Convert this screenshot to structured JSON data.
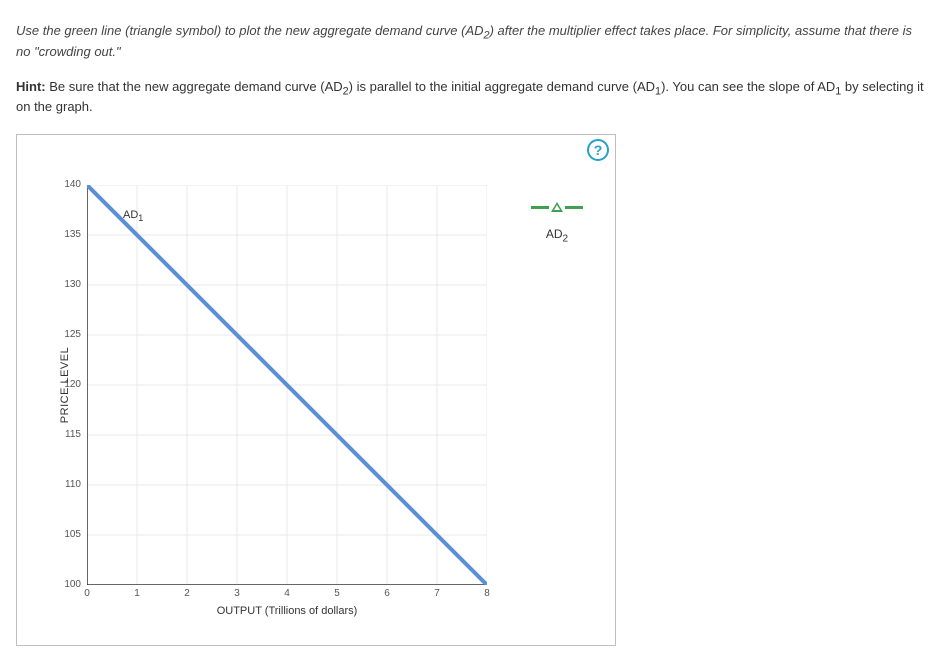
{
  "instruction": {
    "pre": "Use the green line (triangle symbol) to plot the new aggregate demand curve (",
    "var1": "AD",
    "sub1": "2",
    "post1": ") after the multiplier effect takes place. For simplicity, assume that there is no \"crowding out.\""
  },
  "hint": {
    "label": "Hint:",
    "p1": " Be sure that the new aggregate demand curve (",
    "v1": "AD",
    "s1": "2",
    "p2": ") is parallel to the initial aggregate demand curve (",
    "v2": "AD",
    "s2": "1",
    "p3": "). You can see the slope of ",
    "v3": "AD",
    "s3": "1",
    "p4": " by selecting it on the graph."
  },
  "help": "?",
  "chart_data": {
    "type": "line",
    "title": "",
    "xlabel": "OUTPUT (Trillions of dollars)",
    "ylabel": "PRICE LEVEL",
    "xlim": [
      0,
      8
    ],
    "ylim": [
      100,
      140
    ],
    "xticks": [
      0,
      1,
      2,
      3,
      4,
      5,
      6,
      7,
      8
    ],
    "yticks": [
      100,
      105,
      110,
      115,
      120,
      125,
      130,
      135,
      140
    ],
    "series": [
      {
        "name": "AD1",
        "label": "AD",
        "label_sub": "1",
        "color": "#5b8fd6",
        "x": [
          0,
          8
        ],
        "y": [
          140,
          100
        ]
      }
    ],
    "legend": {
      "name": "AD2",
      "label": "AD",
      "label_sub": "2",
      "color": "#3fa04f",
      "symbol": "triangle"
    }
  }
}
